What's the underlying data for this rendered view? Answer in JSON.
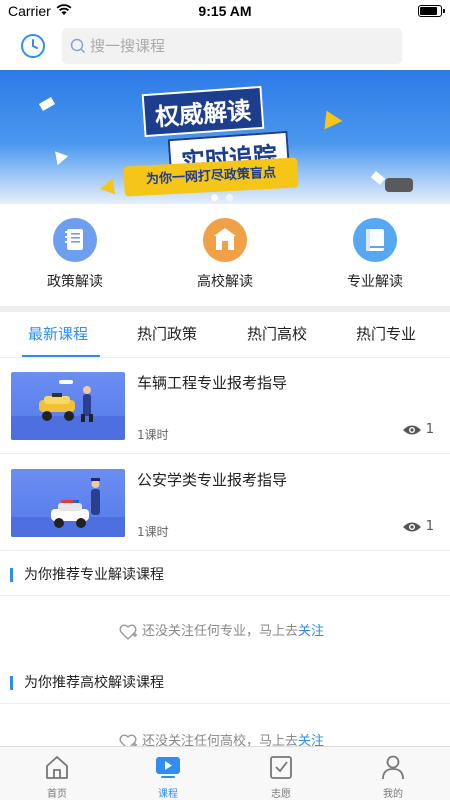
{
  "status_bar": {
    "carrier": "Carrier",
    "time": "9:15 AM",
    "battery_percent": 85
  },
  "search": {
    "placeholder": "搜一搜课程"
  },
  "banner": {
    "headline_1": "权威解读",
    "headline_2": "实时追踪",
    "tagline": "为你一网打尽政策盲点",
    "slide_count": 2,
    "active_slide": 1
  },
  "categories": [
    {
      "label": "政策解读",
      "icon": "policy-doc-icon",
      "color": "#6d9ef0"
    },
    {
      "label": "高校解读",
      "icon": "college-building-icon",
      "color": "#f0a046"
    },
    {
      "label": "专业解读",
      "icon": "book-icon",
      "color": "#56a9f0"
    }
  ],
  "tabs": [
    {
      "label": "最新课程",
      "active": true
    },
    {
      "label": "热门政策",
      "active": false
    },
    {
      "label": "热门高校",
      "active": false
    },
    {
      "label": "热门专业",
      "active": false
    }
  ],
  "courses": [
    {
      "title": "车辆工程专业报考指导",
      "lessons": "1课时",
      "views": "1",
      "thumb": "taxi-illustration"
    },
    {
      "title": "公安学类专业报考指导",
      "lessons": "1课时",
      "views": "1",
      "thumb": "police-car-illustration"
    }
  ],
  "recommend": [
    {
      "heading": "为你推荐专业解读课程",
      "empty_text": "还没关注任何专业，马上去",
      "follow_label": "关注"
    },
    {
      "heading": "为你推荐高校解读课程",
      "empty_text": "还没关注任何高校，马上去",
      "follow_label": "关注"
    }
  ],
  "tabbar": [
    {
      "label": "首页",
      "icon": "home-icon",
      "active": false
    },
    {
      "label": "课程",
      "icon": "play-video-icon",
      "active": true
    },
    {
      "label": "志愿",
      "icon": "checkbox-icon",
      "active": false
    },
    {
      "label": "我的",
      "icon": "user-icon",
      "active": false
    }
  ],
  "colors": {
    "accent": "#2f8ef0",
    "banner_blue": "#2d7ae8",
    "banner_yellow": "#f5c518"
  }
}
